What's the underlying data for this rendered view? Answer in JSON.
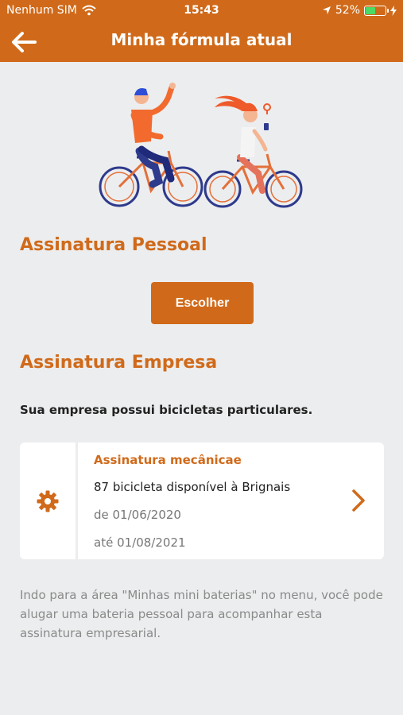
{
  "status_bar": {
    "carrier": "Nenhum SIM",
    "time": "15:43",
    "battery": "52%",
    "battery_level": 0.52,
    "icons": [
      "wifi-icon",
      "location-arrow-icon",
      "battery-icon",
      "charging-icon"
    ]
  },
  "nav": {
    "title": "Minha fórmula atual",
    "back_icon": "arrow-left-icon"
  },
  "personal": {
    "title": "Assinatura Pessoal",
    "choose_label": "Escolher"
  },
  "company": {
    "title": "Assinatura Empresa",
    "note": "Sua empresa possui bicicletas particulares.",
    "card": {
      "icon": "gear-icon",
      "title": "Assinatura mecânicae",
      "availability": "87 bicicleta disponível à Brignais",
      "from": "de 01/06/2020",
      "to": "até 01/08/2021",
      "chevron_icon": "chevron-right-icon"
    }
  },
  "footer_note": "Indo para a área \"Minhas mini baterias\" no menu, você pode alugar uma bateria pessoal para acompanhar esta assinatura empresarial.",
  "colors": {
    "brand": "#d06a1a",
    "background": "#ecedee",
    "bike_blue": "#2e3a8c",
    "bike_orange": "#e3703a"
  }
}
